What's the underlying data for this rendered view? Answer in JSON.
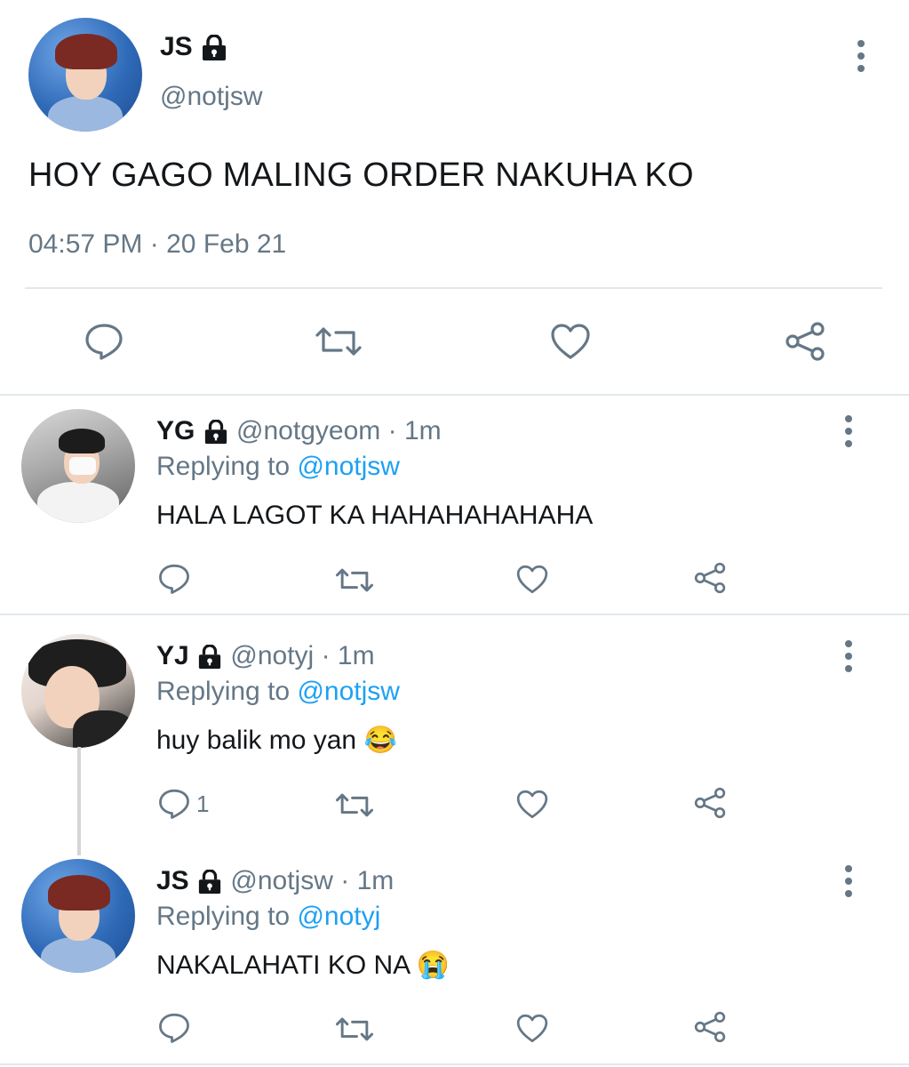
{
  "main_tweet": {
    "name": "JS",
    "handle": "@notjsw",
    "text": "HOY GAGO MALING ORDER NAKUHA KO",
    "time": "04:57 PM",
    "dot": "·",
    "date": "20 Feb 21"
  },
  "replies": [
    {
      "name": "YG",
      "handle": "@notgyeom",
      "time": "1m",
      "replying_label": "Replying to",
      "replying_to": "@notjsw",
      "text": "HALA LAGOT KA HAHAHAHAHAHA",
      "reply_count": ""
    },
    {
      "name": "YJ",
      "handle": "@notyj",
      "time": "1m",
      "replying_label": "Replying to",
      "replying_to": "@notjsw",
      "text": "huy balik mo yan",
      "emoji": "😂",
      "reply_count": "1"
    },
    {
      "name": "JS",
      "handle": "@notjsw",
      "time": "1m",
      "replying_label": "Replying to",
      "replying_to": "@notyj",
      "text": "NAKALAHATI KO NA",
      "emoji": "😭",
      "reply_count": ""
    }
  ],
  "colors": {
    "text": "#14171a",
    "secondary": "#657786",
    "link": "#1da1f2",
    "divider": "#e1e8ed"
  },
  "icons": [
    "lock-icon",
    "more-icon",
    "reply-icon",
    "retweet-icon",
    "like-icon",
    "share-icon"
  ]
}
